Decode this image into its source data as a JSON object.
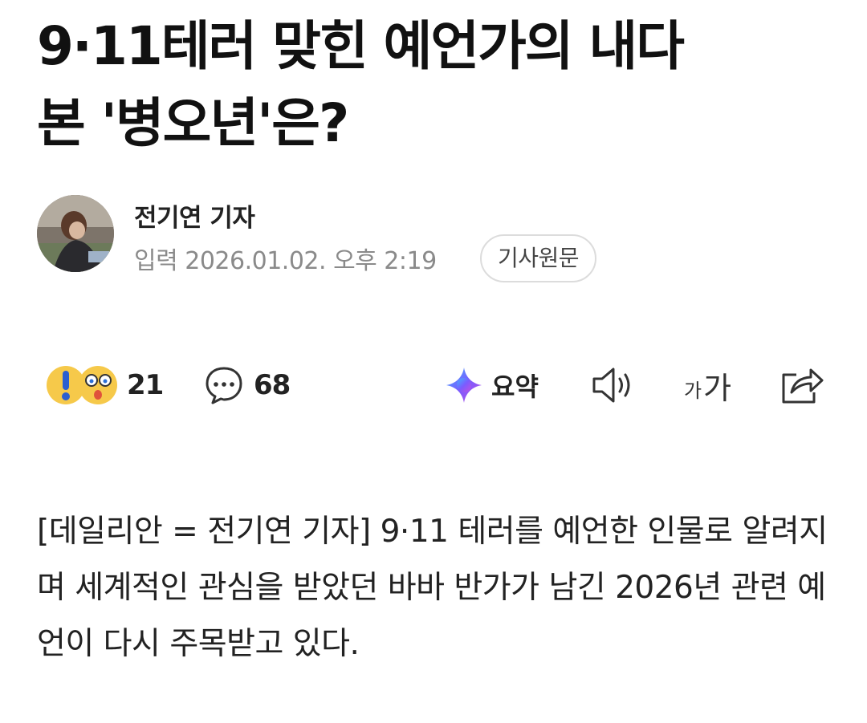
{
  "article": {
    "title_line1": "9·11테러 맞힌 예언가의 내다",
    "title_line2": "본 '병오년'은?",
    "reporter_name": "전기연 기자",
    "published": "입력 2026.01.02. 오후 2:19",
    "original_button": "기사원문",
    "body": "[데일리안 = 전기연 기자] 9·11 테러를 예언한 인물로 알려지며 세계적인 관심을 받았던 바바 반가가 남긴 2026년 관련 예언이 다시 주목받고 있다."
  },
  "toolbar": {
    "reaction_count": "21",
    "comment_count": "68",
    "summary_label": "요약",
    "font_small": "가",
    "font_large": "가",
    "icons": {
      "reaction": "reaction-emoji-icon",
      "comment": "speech-bubble-icon",
      "summary": "ai-sparkle-icon",
      "tts": "speaker-icon",
      "share": "share-icon"
    }
  },
  "colors": {
    "text": "#111111",
    "meta": "#8a8a8a",
    "button_border": "#dcdcdc",
    "icon_stroke": "#333333"
  }
}
